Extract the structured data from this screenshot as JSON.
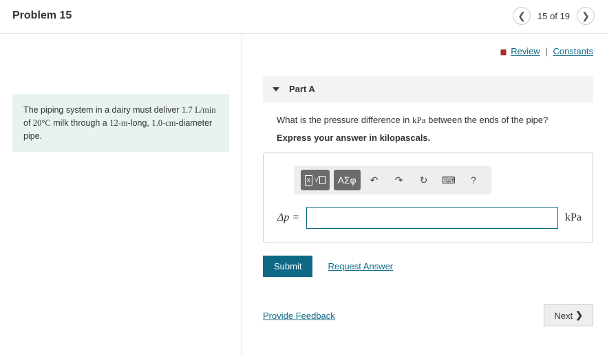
{
  "header": {
    "title": "Problem 15",
    "pager_text": "15 of 19"
  },
  "problem": {
    "text_pre": "The piping system in a dairy must deliver ",
    "rate": "1.7",
    "rate_unit": "L/min",
    "of": " of ",
    "temp": "20°C",
    "mid": " milk through a ",
    "length": "12-m",
    "mid2": "-long, ",
    "diam": "1.0-cm",
    "suffix": "-diameter pipe."
  },
  "links": {
    "review": "Review",
    "constants": "Constants"
  },
  "part": {
    "label": "Part A",
    "question_pre": "What is the pressure difference in ",
    "question_unit": "kPa",
    "question_post": " between the ends of the pipe?",
    "instruction": "Express your answer in kilopascals.",
    "var_label": "Δp =",
    "unit": "kPa",
    "answer_value": ""
  },
  "toolbar": {
    "templates": "x√",
    "greek": "ΑΣφ",
    "undo": "↶",
    "redo": "↷",
    "reset": "↻",
    "keyboard": "⌨",
    "help": "?"
  },
  "actions": {
    "submit": "Submit",
    "request": "Request Answer",
    "feedback": "Provide Feedback",
    "next": "Next"
  }
}
